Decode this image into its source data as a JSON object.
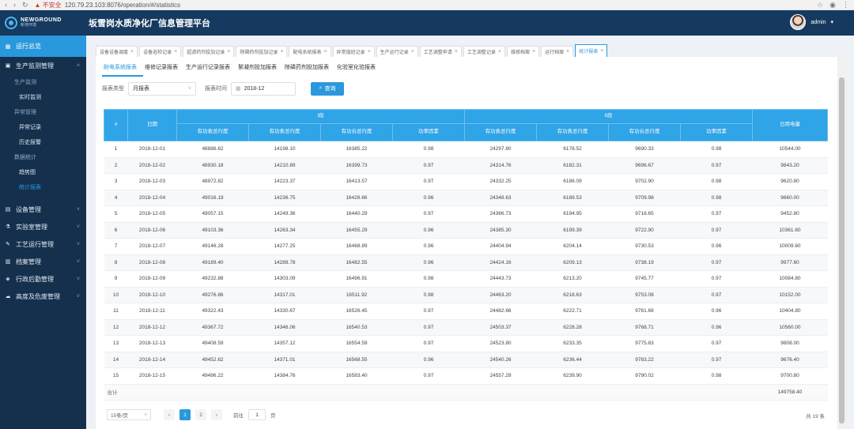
{
  "browser": {
    "warning": "▲ 不安全",
    "url": "120.79.23.103:8076/operation/#/statistics"
  },
  "header": {
    "logo_line1": "NEWGROUND",
    "logo_line2": "新地环境",
    "title": "坂雪岗水质净化厂信息管理平台",
    "user": "admin"
  },
  "sidebar": {
    "home": "运行总览",
    "groups": [
      {
        "label": "生产监测管理",
        "expanded": true
      },
      {
        "label": "设备管理"
      },
      {
        "label": "实验室管理"
      },
      {
        "label": "工艺运行管理"
      },
      {
        "label": "档案管理"
      },
      {
        "label": "行政后勤管理"
      },
      {
        "label": "高度及危废管理"
      }
    ],
    "subs": {
      "monitor_head": "生产监测",
      "realtime": "实时监测",
      "alarm_head": "异常管理",
      "alarm_records": "异常记录",
      "history_alarm": "历史报警",
      "stats_head": "数据统计",
      "trend": "趋势图",
      "report": "统计报表"
    }
  },
  "tabs": [
    {
      "label": "设备设备调度"
    },
    {
      "label": "设备巡检记录"
    },
    {
      "label": "超滤药剂投加记录"
    },
    {
      "label": "除磷药剂投加记录"
    },
    {
      "label": "配电系统报表"
    },
    {
      "label": "异常值班记录"
    },
    {
      "label": "生产运行记录"
    },
    {
      "label": "工艺调整申请"
    },
    {
      "label": "工艺调整记录"
    },
    {
      "label": "维修档案"
    },
    {
      "label": "运行档案"
    },
    {
      "label": "统计报表",
      "active": true
    }
  ],
  "report_tabs": [
    {
      "label": "耐电系统报表",
      "active": true
    },
    {
      "label": "维修记录报表"
    },
    {
      "label": "生产运行记录报表"
    },
    {
      "label": "絮凝剂投加报表"
    },
    {
      "label": "除磷药剂投加报表"
    },
    {
      "label": "化验室化验报表"
    }
  ],
  "filters": {
    "type_label": "报表类型",
    "type_value": "月报表",
    "time_label": "报表时间",
    "time_value": "2018-12",
    "query_button": "查询"
  },
  "table": {
    "h_index": "#",
    "h_date": "日期",
    "section1": "I段",
    "section2": "II段",
    "h_active_total": "有功表总行度",
    "h_reactive_total": "有功表总行度",
    "h_active_valley": "有功谷总行度",
    "h_power_factor": "功率因素",
    "h_daily_power": "日用电量",
    "rows": [
      [
        "1",
        "2018-12-01",
        "48886.62",
        "14198.10",
        "16385.22",
        "0.98",
        "24297.80",
        "6178.52",
        "9690.33",
        "0.98",
        "10544.00"
      ],
      [
        "2",
        "2018-12-02",
        "48930.18",
        "14210.89",
        "16399.73",
        "0.97",
        "24314.76",
        "6182.31",
        "9696.67",
        "0.97",
        "9843.20"
      ],
      [
        "3",
        "2018-12-03",
        "48972.82",
        "14223.37",
        "16413.57",
        "0.97",
        "24332.25",
        "6186.09",
        "9702.90",
        "0.98",
        "9620.80"
      ],
      [
        "4",
        "2018-12-04",
        "49016.19",
        "14236.75",
        "16426.66",
        "0.96",
        "24348.63",
        "6189.53",
        "9709.98",
        "0.98",
        "9660.00"
      ],
      [
        "5",
        "2018-12-05",
        "49057.15",
        "14249.36",
        "16440.29",
        "0.97",
        "24366.73",
        "6194.95",
        "9716.65",
        "0.97",
        "9452.80"
      ],
      [
        "6",
        "2018-12-06",
        "49103.36",
        "14263.34",
        "16455.29",
        "0.96",
        "24385.30",
        "6199.39",
        "9722.90",
        "0.97",
        "10361.60"
      ],
      [
        "7",
        "2018-12-07",
        "49146.28",
        "14277.25",
        "16468.89",
        "0.96",
        "24404.94",
        "6204.14",
        "9730.53",
        "0.96",
        "10009.60"
      ],
      [
        "8",
        "2018-12-08",
        "49189.40",
        "14289.78",
        "16482.55",
        "0.96",
        "24424.16",
        "6209.13",
        "9738.19",
        "0.97",
        "9977.60"
      ],
      [
        "9",
        "2018-12-09",
        "49232.88",
        "14303.09",
        "16496.91",
        "0.98",
        "24443.73",
        "6213.20",
        "9745.77",
        "0.97",
        "10084.80"
      ],
      [
        "10",
        "2018-12-10",
        "49276.86",
        "14317.01",
        "16511.92",
        "0.98",
        "24463.20",
        "6218.63",
        "9753.08",
        "0.97",
        "10152.00"
      ],
      [
        "11",
        "2018-12-11",
        "49322.43",
        "14330.67",
        "16526.45",
        "0.97",
        "24482.66",
        "6222.71",
        "9761.68",
        "0.96",
        "10404.80"
      ],
      [
        "12",
        "2018-12-12",
        "49367.72",
        "14346.06",
        "16540.53",
        "0.97",
        "24503.37",
        "6228.28",
        "9768.71",
        "0.96",
        "10560.00"
      ],
      [
        "13",
        "2018-12-13",
        "49408.59",
        "14357.12",
        "16554.59",
        "0.97",
        "24523.80",
        "6233.35",
        "9775.83",
        "0.97",
        "9808.00"
      ],
      [
        "14",
        "2018-12-14",
        "49452.62",
        "14371.01",
        "16568.55",
        "0.96",
        "24540.26",
        "6236.44",
        "9783.22",
        "0.97",
        "9676.40"
      ],
      [
        "15",
        "2018-12-15",
        "49496.22",
        "14384.76",
        "16583.40",
        "0.97",
        "24557.29",
        "6239.90",
        "9790.02",
        "0.98",
        "9700.80"
      ]
    ],
    "total_label": "合计",
    "total_value": "149758.40"
  },
  "pagination": {
    "page_size": "15条/页",
    "prev": "‹",
    "pages": [
      "1",
      "2"
    ],
    "next": "›",
    "goto_label": "前往",
    "goto_value": "1",
    "goto_suffix": "页",
    "total": "共 19 条"
  }
}
